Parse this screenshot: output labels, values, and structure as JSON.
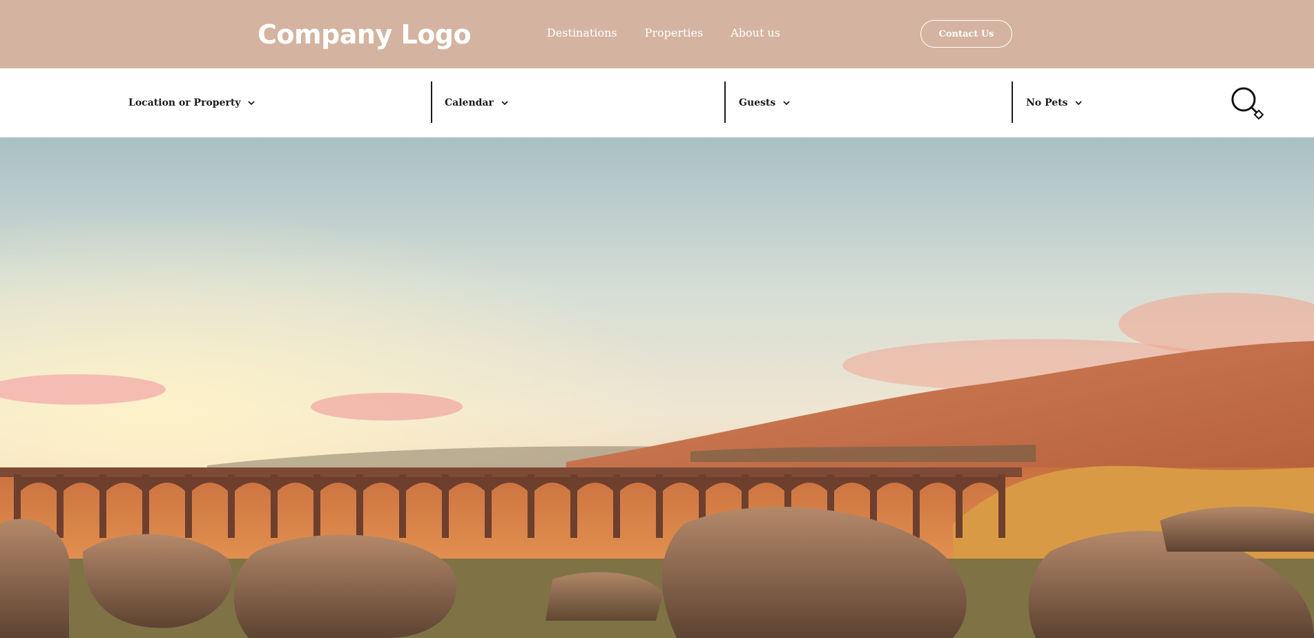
{
  "header": {
    "logo_text": "Company Logo",
    "nav": [
      "Destinations",
      "Properties",
      "About us"
    ],
    "contact_label": "Contact Us",
    "background_color": "#d4b4a0"
  },
  "search": {
    "fields": [
      {
        "label": "Location or Property",
        "icon": "chevron-down-icon"
      },
      {
        "label": "Calendar",
        "icon": "chevron-down-icon"
      },
      {
        "label": "Guests",
        "icon": "chevron-down-icon"
      },
      {
        "label": "No Pets",
        "icon": "chevron-down-icon"
      }
    ],
    "submit_icon": "search-icon"
  },
  "hero": {
    "image": "sunset-viaduct-landscape"
  }
}
